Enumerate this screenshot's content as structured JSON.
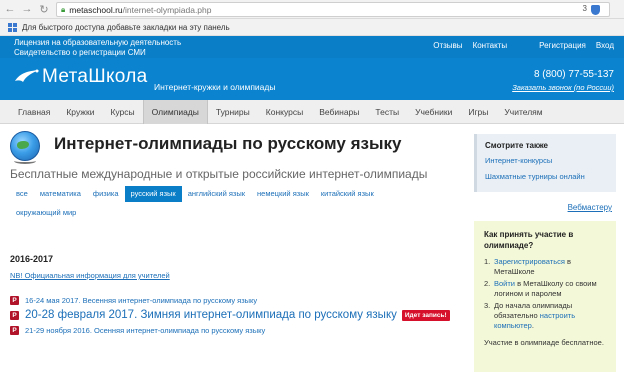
{
  "browser": {
    "url_host": "metaschool.ru",
    "url_path": "/internet-olympiada.php",
    "ext_count": "3",
    "bookmarks_hint": "Для быстрого доступа добавьте закладки на эту панель"
  },
  "header": {
    "license_line1": "Лицензия на образовательную деятельность",
    "license_line2": "Свидетельство о регистрации СМИ",
    "links": [
      "Отзывы",
      "Контакты",
      "Регистрация",
      "Вход"
    ],
    "logo": "МетаШкола",
    "tagline": "Интернет-кружки и олимпиады",
    "phone": "8 (800) 77-55-137",
    "callback": "Заказать звонок (по России)"
  },
  "menu": {
    "items": [
      "Главная",
      "Кружки",
      "Курсы",
      "Олимпиады",
      "Турниры",
      "Конкурсы",
      "Вебинары",
      "Тесты",
      "Учебники",
      "Игры",
      "Учителям"
    ],
    "active": "Олимпиады"
  },
  "main": {
    "title": "Интернет-олимпиады по русскому языку",
    "subtitle": "Бесплатные международные и открытые российские интернет-олимпиады",
    "tags": [
      "все",
      "математика",
      "физика",
      "русский язык",
      "английский язык",
      "немецкий язык",
      "китайский язык",
      "окружающий мир"
    ],
    "active_tag": "русский язык",
    "vmaster": "Вебмастеру",
    "year": "2016-2017",
    "nb": "NB! Официальная информация для учителей",
    "events": [
      {
        "icon": "P",
        "text": "16-24 мая 2017. Весенняя интернет-олимпиада по русскому языку"
      },
      {
        "icon": "P",
        "text": "20-28 февраля 2017. Зимняя интернет-олимпиада по русскому языку",
        "badge": "Идет запись!"
      },
      {
        "icon": "P",
        "text": "21-29 ноября 2016. Осенняя интернет-олимпиада по русскому языку"
      }
    ]
  },
  "sidebar": {
    "see_title": "Смотрите также",
    "see_links": [
      "Интернет-конкурсы",
      "Шахматные турниры онлайн"
    ],
    "part_title": "Как принять участие в олимпиаде?",
    "step1_link": "Зарегистрироваться",
    "step1_rest": " в МетаШколе",
    "step2_link": "Войти",
    "step2_rest": " в МетаШколу со своим логином и паролем",
    "step3_text": "До начала олимпиады обязательно ",
    "step3_link": "настроить компьютер",
    "step3_end": ".",
    "free": "Участие в олимпиаде бесплатное.",
    "colors": {
      "accent": "#0b7ec8",
      "badge": "#d6102a",
      "green_box": "#f3f8d8"
    }
  }
}
